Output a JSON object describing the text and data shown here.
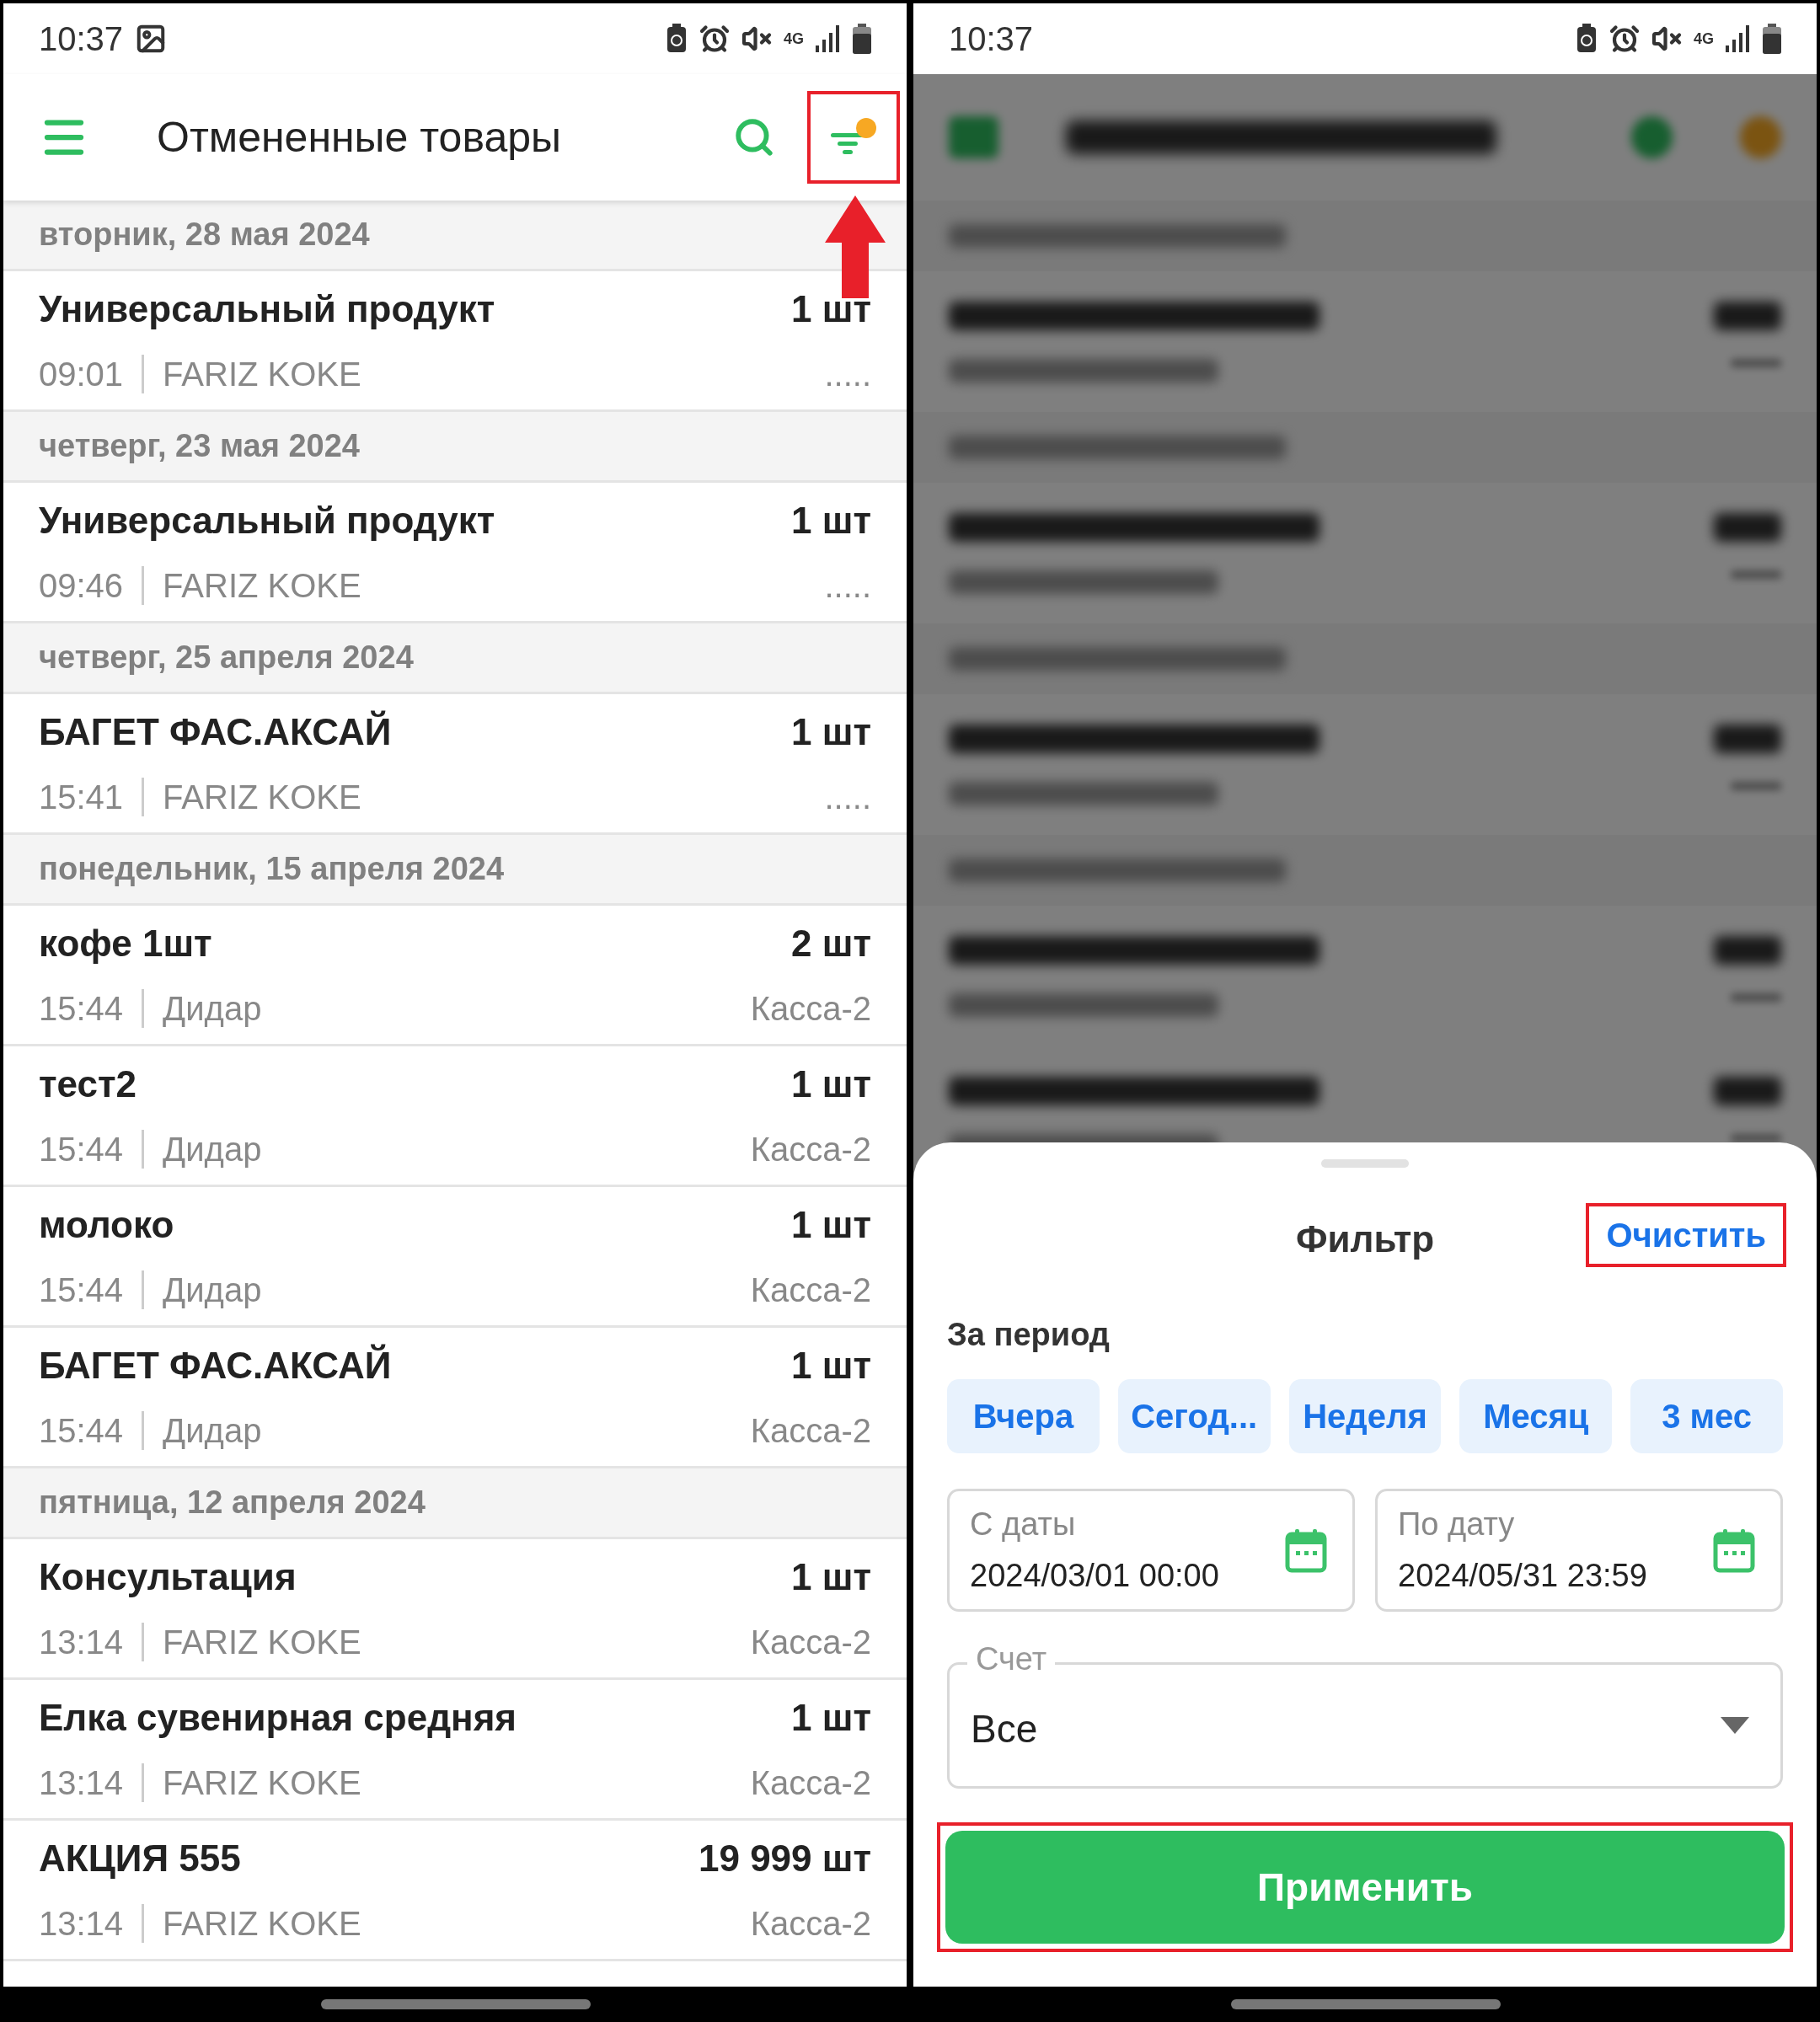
{
  "left_screen": {
    "status_bar": {
      "time": "10:37",
      "photo_notification": true,
      "network": "4G"
    },
    "toolbar": {
      "title": "Отмененные товары",
      "filter_active": true
    },
    "groups": [
      {
        "date": "вторник, 28 мая 2024",
        "items": [
          {
            "name": "Универсальный продукт",
            "qty": "1 шт",
            "time": "09:01",
            "user": "FARIZ KOKE",
            "register": "....."
          }
        ]
      },
      {
        "date": "четверг, 23 мая 2024",
        "items": [
          {
            "name": "Универсальный продукт",
            "qty": "1 шт",
            "time": "09:46",
            "user": "FARIZ KOKE",
            "register": "....."
          }
        ]
      },
      {
        "date": "четверг, 25 апреля 2024",
        "items": [
          {
            "name": "БАГЕТ ФАС.АКСАЙ",
            "qty": "1 шт",
            "time": "15:41",
            "user": "FARIZ KOKE",
            "register": "....."
          }
        ]
      },
      {
        "date": "понедельник, 15 апреля 2024",
        "items": [
          {
            "name": "кофе 1шт",
            "qty": "2 шт",
            "time": "15:44",
            "user": "Дидар",
            "register": "Касса-2"
          },
          {
            "name": "тест2",
            "qty": "1 шт",
            "time": "15:44",
            "user": "Дидар",
            "register": "Касса-2"
          },
          {
            "name": "молоко",
            "qty": "1 шт",
            "time": "15:44",
            "user": "Дидар",
            "register": "Касса-2"
          },
          {
            "name": "БАГЕТ ФАС.АКСАЙ",
            "qty": "1 шт",
            "time": "15:44",
            "user": "Дидар",
            "register": "Касса-2"
          }
        ]
      },
      {
        "date": "пятница, 12 апреля 2024",
        "items": [
          {
            "name": "Консультация",
            "qty": "1 шт",
            "time": "13:14",
            "user": "FARIZ KOKE",
            "register": "Касса-2"
          },
          {
            "name": "Елка сувенирная средняя",
            "qty": "1 шт",
            "time": "13:14",
            "user": "FARIZ KOKE",
            "register": "Касса-2"
          },
          {
            "name": "АКЦИЯ 555",
            "qty": "19 999 шт",
            "time": "13:14",
            "user": "FARIZ KOKE",
            "register": "Касса-2"
          }
        ]
      }
    ]
  },
  "right_screen": {
    "status_bar": {
      "time": "10:37",
      "network": "4G"
    },
    "filter_sheet": {
      "title": "Фильтр",
      "clear": "Очистить",
      "period_label": "За период",
      "periods": [
        {
          "label": "Вчера",
          "selected": false
        },
        {
          "label": "Сегод...",
          "selected": false
        },
        {
          "label": "Неделя",
          "selected": false
        },
        {
          "label": "Месяц",
          "selected": false
        },
        {
          "label": "3 мес",
          "selected": false
        }
      ],
      "from": {
        "label": "С даты",
        "value": "2024/03/01 00:00"
      },
      "to": {
        "label": "По дату",
        "value": "2024/05/31 23:59"
      },
      "account": {
        "label": "Счет",
        "value": "Все"
      },
      "apply": "Применить"
    }
  }
}
